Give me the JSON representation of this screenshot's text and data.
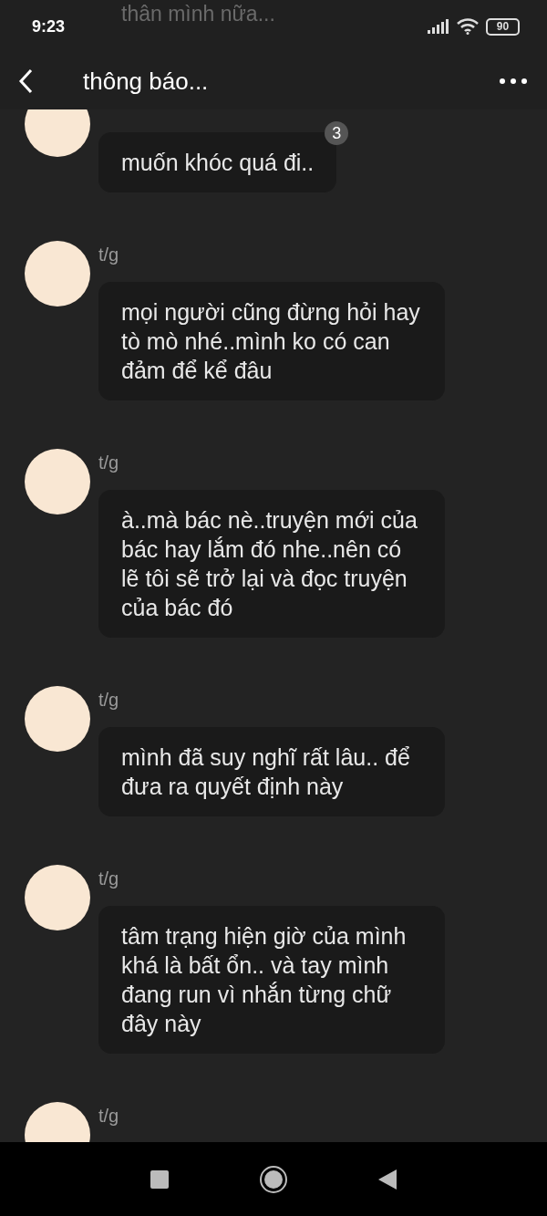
{
  "status_bar": {
    "time": "9:23",
    "battery": "90"
  },
  "header": {
    "title": "thông báo...",
    "behind_text": "thân mình nữa..."
  },
  "messages": [
    {
      "text": "muốn khóc quá đi..",
      "badge": "3"
    },
    {
      "sender": "t/g",
      "text": "mọi người cũng đừng hỏi hay tò mò nhé..mình ko có can đảm để kể đâu"
    },
    {
      "sender": "t/g",
      "text": "à..mà bác nè..truyện mới của bác hay lắm đó nhe..nên có lẽ tôi sẽ trở lại và đọc truyện của bác đó"
    },
    {
      "sender": "t/g",
      "text": "mình đã suy nghĩ rất lâu.. để đưa ra quyết định này"
    },
    {
      "sender": "t/g",
      "text": "tâm trạng hiện giờ của mình khá là bất ổn.. và tay mình đang run vì nhắn từng chữ đây này"
    },
    {
      "sender": "t/g"
    }
  ]
}
